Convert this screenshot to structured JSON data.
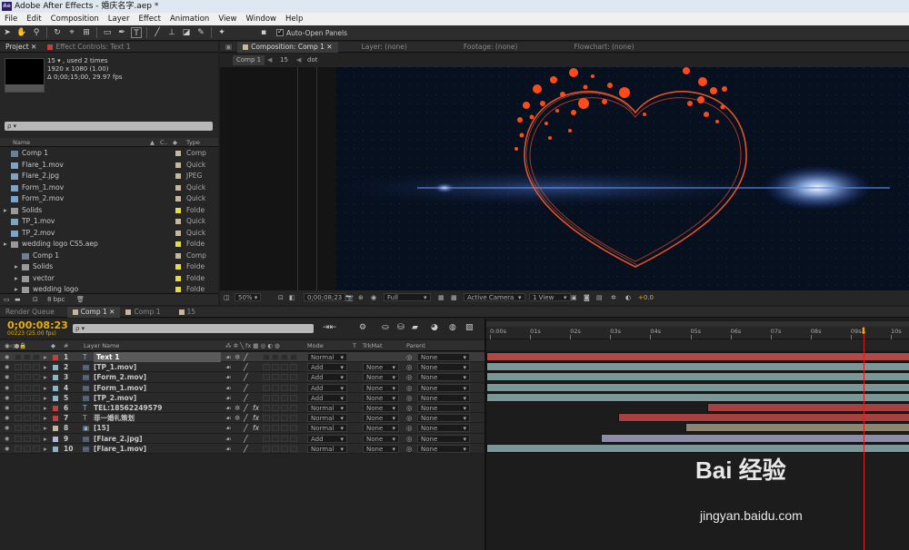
{
  "app": {
    "title": "Adobe After Effects - 婚庆名字.aep *",
    "logo": "Ae"
  },
  "menu": [
    "File",
    "Edit",
    "Composition",
    "Layer",
    "Effect",
    "Animation",
    "View",
    "Window",
    "Help"
  ],
  "toolbar": {
    "auto_open_label": "Auto-Open Panels"
  },
  "project_panel": {
    "tab_project": "Project",
    "tab_effect": "Effect Controls: Text 1",
    "info_name": "15 ▾ , used 2 times",
    "info_size": "1920 x 1080 (1.00)",
    "info_dur": "Δ 0;00;15;00, 29.97 fps",
    "search_placeholder": "ρ ▾",
    "col_name": "Name",
    "col_type": "Type",
    "items": [
      {
        "name": "Comp 1",
        "color": "#c8b89a",
        "type": "Comp",
        "kind": "comp",
        "indent": 0
      },
      {
        "name": "Flare_1.mov",
        "color": "#c8b89a",
        "type": "Quick",
        "kind": "file",
        "indent": 0
      },
      {
        "name": "Flare_2.jpg",
        "color": "#c8b89a",
        "type": "JPEG",
        "kind": "file",
        "indent": 0
      },
      {
        "name": "Form_1.mov",
        "color": "#c8b89a",
        "type": "Quick",
        "kind": "file",
        "indent": 0
      },
      {
        "name": "Form_2.mov",
        "color": "#c8b89a",
        "type": "Quick",
        "kind": "file",
        "indent": 0
      },
      {
        "name": "Solids",
        "color": "#e8d84a",
        "type": "Folde",
        "kind": "folder",
        "indent": 0
      },
      {
        "name": "TP_1.mov",
        "color": "#c8b89a",
        "type": "Quick",
        "kind": "file",
        "indent": 0
      },
      {
        "name": "TP_2.mov",
        "color": "#c8b89a",
        "type": "Quick",
        "kind": "file",
        "indent": 0
      },
      {
        "name": "wedding logo CS5.aep",
        "color": "#e8d84a",
        "type": "Folde",
        "kind": "folder",
        "indent": 0
      },
      {
        "name": "Comp 1",
        "color": "#c8b89a",
        "type": "Comp",
        "kind": "comp",
        "indent": 1
      },
      {
        "name": "Solids",
        "color": "#e8d84a",
        "type": "Folde",
        "kind": "folder",
        "indent": 1
      },
      {
        "name": "vector",
        "color": "#e8d84a",
        "type": "Folde",
        "kind": "folder",
        "indent": 1
      },
      {
        "name": "wedding logo",
        "color": "#e8d84a",
        "type": "Folde",
        "kind": "folder",
        "indent": 1
      }
    ],
    "bpc": "8 bpc"
  },
  "comp_panel": {
    "tab_comp": "Composition: Comp 1",
    "tab_layer": "Layer: (none)",
    "tab_footage": "Footage: (none)",
    "tab_flow": "Flowchart: (none)",
    "crumbs": [
      "Comp 1",
      "15",
      "dot"
    ],
    "zoom": "50%",
    "timecode": "0;00;08;23",
    "resolution": "Full",
    "camera": "Active Camera",
    "view": "1 View",
    "exposure": "+0.0"
  },
  "timeline": {
    "tab_render": "Render Queue",
    "tab_comp1": "Comp 1",
    "tab_comp1b": "Comp 1",
    "tab_15": "15",
    "timecode": "0;00:08:23",
    "fps": "00223 (25.00 fps)",
    "search_placeholder": "ρ ▾",
    "col_layer_name": "Layer Name",
    "col_mode": "Mode",
    "col_t": "T",
    "col_trkmat": "TrkMat",
    "col_parent": "Parent",
    "ruler": [
      "0:00s",
      "01s",
      "02s",
      "03s",
      "04s",
      "05s",
      "06s",
      "07s",
      "08s",
      "09s",
      "10s"
    ],
    "playhead_fraction": 0.888,
    "layers": [
      {
        "num": "1",
        "name": "Text 1",
        "color": "#c04040",
        "icon": "T",
        "mode": "Normal",
        "trkmat": "",
        "parent": "None",
        "fx": false,
        "selected": true,
        "bar_color": "#b04848",
        "start": 0.0,
        "end": 1.0
      },
      {
        "num": "2",
        "name": "[TP_1.mov]",
        "color": "#8ab4c8",
        "icon": "F",
        "mode": "Add",
        "trkmat": "None",
        "parent": "None",
        "fx": false,
        "selected": false,
        "bar_color": "#7a9696",
        "start": 0.0,
        "end": 1.0
      },
      {
        "num": "3",
        "name": "[Form_2.mov]",
        "color": "#8ab4c8",
        "icon": "F",
        "mode": "Add",
        "trkmat": "None",
        "parent": "None",
        "fx": false,
        "selected": false,
        "bar_color": "#7a9696",
        "start": 0.0,
        "end": 1.0
      },
      {
        "num": "4",
        "name": "[Form_1.mov]",
        "color": "#8ab4c8",
        "icon": "F",
        "mode": "Add",
        "trkmat": "None",
        "parent": "None",
        "fx": false,
        "selected": false,
        "bar_color": "#7a9696",
        "start": 0.0,
        "end": 1.0
      },
      {
        "num": "5",
        "name": "[TP_2.mov]",
        "color": "#8ab4c8",
        "icon": "F",
        "mode": "Add",
        "trkmat": "None",
        "parent": "None",
        "fx": false,
        "selected": false,
        "bar_color": "#7a9696",
        "start": 0.0,
        "end": 1.0
      },
      {
        "num": "6",
        "name": "TEL:18562249579",
        "color": "#c04040",
        "icon": "T",
        "mode": "Normal",
        "trkmat": "None",
        "parent": "None",
        "fx": true,
        "selected": false,
        "bar_color": "#a84040",
        "start": 0.52,
        "end": 1.0
      },
      {
        "num": "7",
        "name": "菲一婚礼策划",
        "color": "#c04040",
        "icon": "T",
        "mode": "Normal",
        "trkmat": "None",
        "parent": "None",
        "fx": true,
        "selected": false,
        "bar_color": "#a84040",
        "start": 0.31,
        "end": 1.0
      },
      {
        "num": "8",
        "name": "[15]",
        "color": "#c8b89a",
        "icon": "C",
        "mode": "Normal",
        "trkmat": "None",
        "parent": "None",
        "fx": true,
        "selected": false,
        "bar_color": "#8e8472",
        "start": 0.47,
        "end": 1.0
      },
      {
        "num": "9",
        "name": "[Flare_2.jpg]",
        "color": "#b4b4dc",
        "icon": "F",
        "mode": "Add",
        "trkmat": "None",
        "parent": "None",
        "fx": false,
        "selected": false,
        "bar_color": "#8c8ca8",
        "start": 0.27,
        "end": 1.0
      },
      {
        "num": "10",
        "name": "[Flare_1.mov]",
        "color": "#8ab4c8",
        "icon": "F",
        "mode": "Normal",
        "trkmat": "None",
        "parent": "None",
        "fx": false,
        "selected": false,
        "bar_color": "#7a9696",
        "start": 0.0,
        "end": 1.0
      }
    ]
  },
  "watermark": {
    "brand": "Bai 经验",
    "url": "jingyan.baidu.com"
  }
}
